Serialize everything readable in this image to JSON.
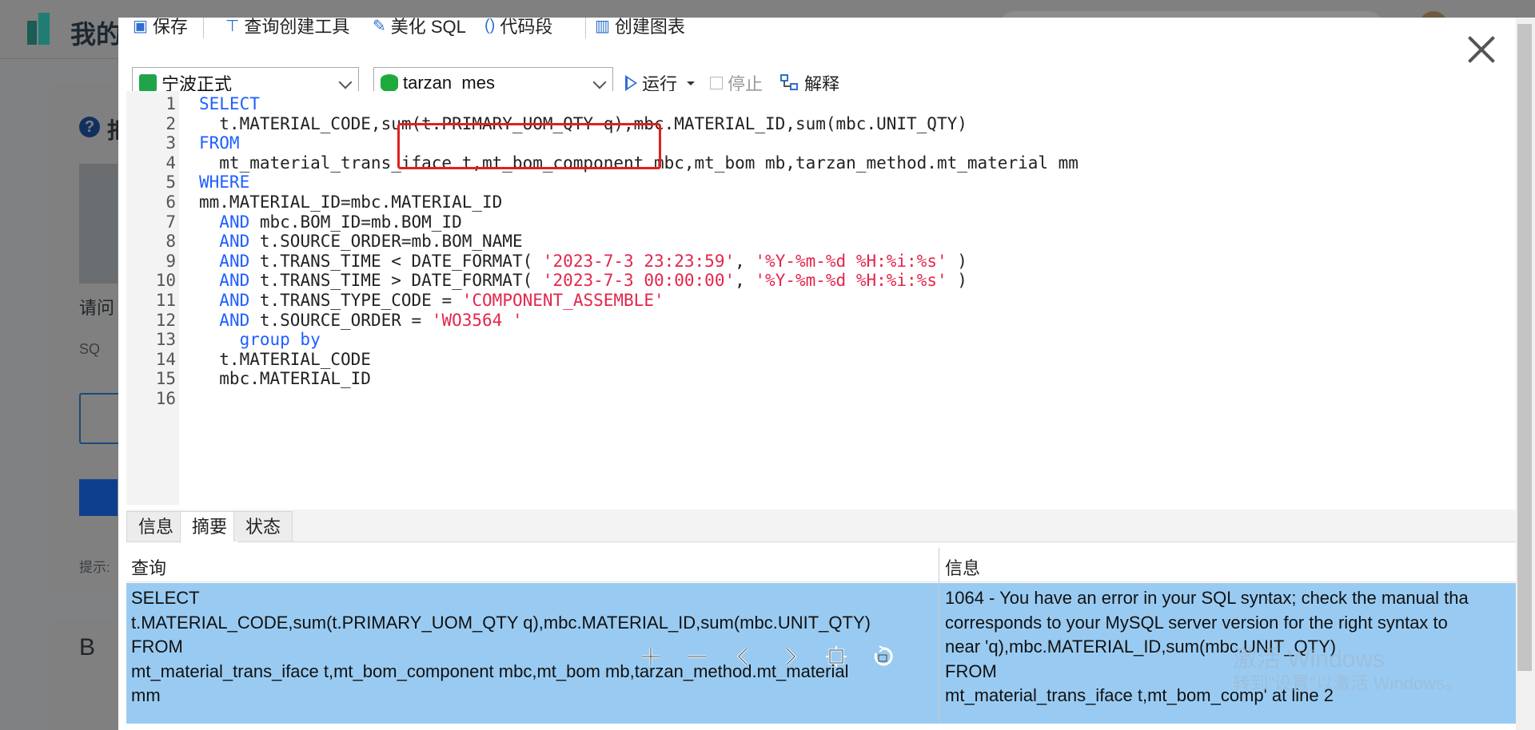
{
  "background": {
    "app_title": "我的",
    "partial_texts": [
      "拒",
      "请问",
      "SQ",
      "提示:",
      "B"
    ]
  },
  "toolbar": {
    "save_label": "保存",
    "query_builder_label": "查询创建工具",
    "beautify_label": "美化 SQL",
    "snippet_label": "代码段",
    "chart_label": "创建图表"
  },
  "connection": {
    "selected": "宁波正式",
    "icon": "connection-icon"
  },
  "database": {
    "selected": "tarzan_mes",
    "icon": "database-icon"
  },
  "actions": {
    "run_label": "运行",
    "stop_label": "停止",
    "explain_label": "解释"
  },
  "editor": {
    "lines": [
      [
        {
          "t": "SELECT",
          "k": "kw"
        }
      ],
      [
        {
          "t": "  t.MATERIAL_CODE,sum(t.PRIMARY_UOM_QTY q),mbc.MATERIAL_ID,sum(mbc.UNIT_QTY)"
        }
      ],
      [
        {
          "t": "FROM",
          "k": "kw"
        }
      ],
      [
        {
          "t": "  mt_material_trans_iface t,mt_bom_component mbc,mt_bom mb,tarzan_method.mt_material mm"
        }
      ],
      [
        {
          "t": "WHERE",
          "k": "kw"
        }
      ],
      [
        {
          "t": "mm.MATERIAL_ID=mbc.MATERIAL_ID"
        }
      ],
      [
        {
          "t": "  "
        },
        {
          "t": "AND",
          "k": "kw"
        },
        {
          "t": " mbc.BOM_ID=mb.BOM_ID"
        }
      ],
      [
        {
          "t": "  "
        },
        {
          "t": "AND",
          "k": "kw"
        },
        {
          "t": " t.SOURCE_ORDER=mb.BOM_NAME"
        }
      ],
      [
        {
          "t": "  "
        },
        {
          "t": "AND",
          "k": "kw"
        },
        {
          "t": " t.TRANS_TIME < DATE_FORMAT( "
        },
        {
          "t": "'2023-7-3 23:23:59'",
          "k": "str"
        },
        {
          "t": ", "
        },
        {
          "t": "'%Y-%m-%d %H:%i:%s'",
          "k": "str"
        },
        {
          "t": " )"
        }
      ],
      [
        {
          "t": "  "
        },
        {
          "t": "AND",
          "k": "kw"
        },
        {
          "t": " t.TRANS_TIME > DATE_FORMAT( "
        },
        {
          "t": "'2023-7-3 00:00:00'",
          "k": "str"
        },
        {
          "t": ", "
        },
        {
          "t": "'%Y-%m-%d %H:%i:%s'",
          "k": "str"
        },
        {
          "t": " )"
        }
      ],
      [
        {
          "t": "  "
        },
        {
          "t": "AND",
          "k": "kw"
        },
        {
          "t": " t.TRANS_TYPE_CODE = "
        },
        {
          "t": "'COMPONENT_ASSEMBLE'",
          "k": "str"
        }
      ],
      [
        {
          "t": "  "
        },
        {
          "t": "AND",
          "k": "kw"
        },
        {
          "t": " t.SOURCE_ORDER = "
        },
        {
          "t": "'WO3564 '",
          "k": "str"
        }
      ],
      [
        {
          "t": "    "
        },
        {
          "t": "group by",
          "k": "kw"
        }
      ],
      [
        {
          "t": "  t.MATERIAL_CODE"
        }
      ],
      [
        {
          "t": "  mbc.MATERIAL_ID"
        }
      ],
      []
    ]
  },
  "tabs": [
    {
      "label": "信息",
      "active": false
    },
    {
      "label": "摘要",
      "active": true
    },
    {
      "label": "状态",
      "active": false
    }
  ],
  "results": {
    "columns": [
      "查询",
      "信息"
    ],
    "query_text": "SELECT\nt.MATERIAL_CODE,sum(t.PRIMARY_UOM_QTY q),mbc.MATERIAL_ID,sum(mbc.UNIT_QTY)\nFROM\nmt_material_trans_iface t,mt_bom_component mbc,mt_bom mb,tarzan_method.mt_material\nmm",
    "info_text": "1064 - You have an error in your SQL syntax; check the manual tha\ncorresponds to your MySQL server version for the right syntax to\nnear 'q),mbc.MATERIAL_ID,sum(mbc.UNIT_QTY)\nFROM\nmt_material_trans_iface t,mt_bom_comp' at line 2"
  },
  "watermark": {
    "line1": "激活 Windows",
    "line2": "转到\"设置\"以激活 Windows。"
  },
  "colors": {
    "keyword": "#1f5fff",
    "string": "#e3264b",
    "highlight_box": "#e02020",
    "selected_row": "#99cbf2"
  }
}
